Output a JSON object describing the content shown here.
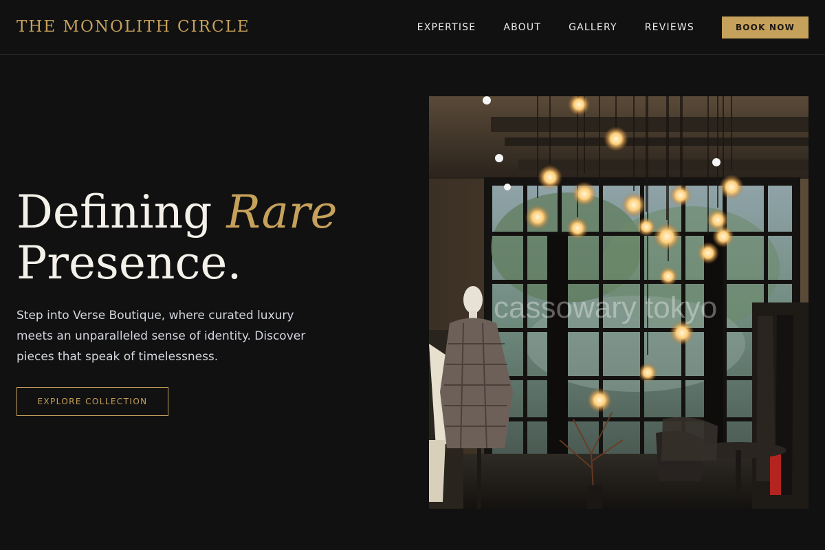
{
  "brand": {
    "name": "THE MONOLITH CIRCLE"
  },
  "nav": {
    "items": [
      "EXPERTISE",
      "ABOUT",
      "GALLERY",
      "REVIEWS"
    ],
    "book_label": "BOOK NOW"
  },
  "hero": {
    "title_part1": "Defining ",
    "title_accent": "Rare",
    "title_part2": "Presence.",
    "description": "Step into Verse Boutique, where curated luxury meets an unparalleled sense of identity. Discover pieces that speak of timelessness.",
    "cta_label": "EXPLORE COLLECTION",
    "image_watermark": "cassowary tokyo"
  },
  "colors": {
    "background": "#111111",
    "accent_gold": "#c6a15b",
    "text_light": "#f4f1ea",
    "text_muted": "#d3d6dd"
  }
}
